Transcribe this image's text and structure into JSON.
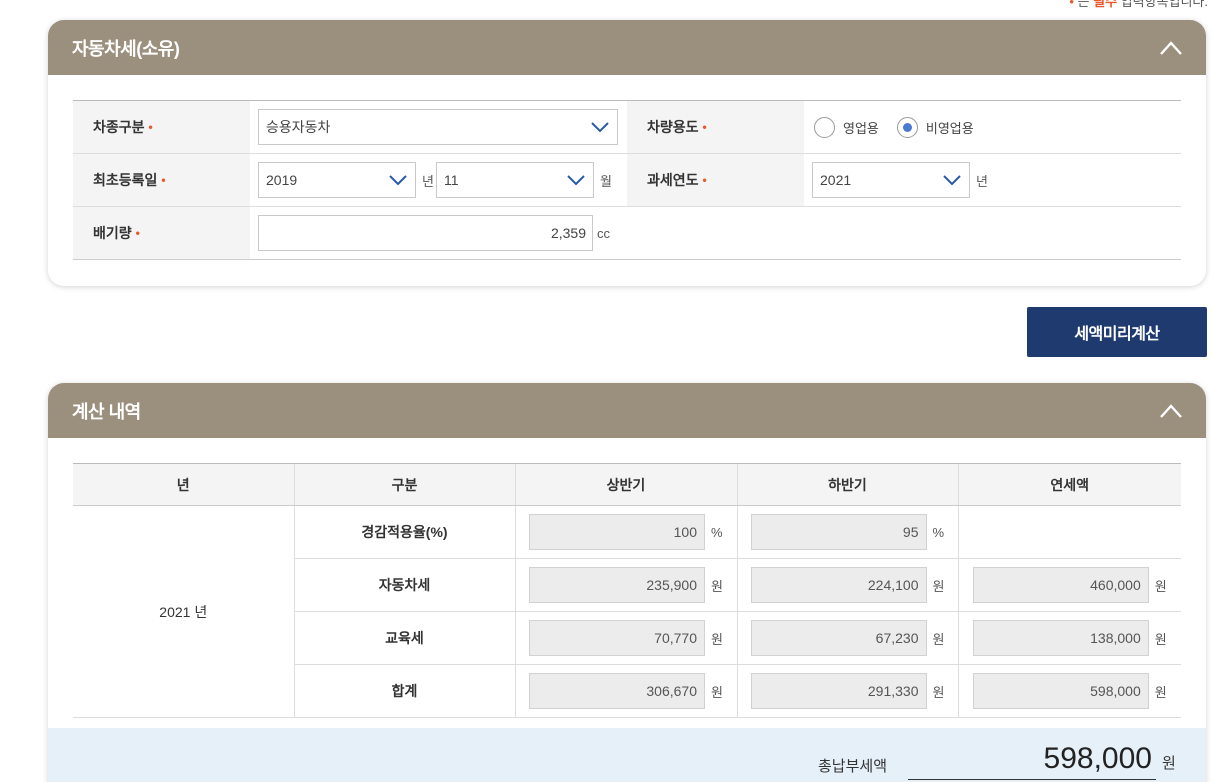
{
  "note": {
    "mark": "•",
    "prefix": "는",
    "required_word": "필수",
    "suffix": "입력항목입니다."
  },
  "vehicle_card": {
    "title": "자동차세(소유)",
    "car_type": {
      "label": "차종구분",
      "value": "승용자동차"
    },
    "usage": {
      "label": "차량용도",
      "options": [
        "영업용",
        "비영업용"
      ],
      "selected": "비영업용"
    },
    "first_reg": {
      "label": "최초등록일",
      "year": "2019",
      "year_unit": "년",
      "month": "11",
      "month_unit": "월"
    },
    "tax_year": {
      "label": "과세연도",
      "value": "2021",
      "unit": "년"
    },
    "displacement": {
      "label": "배기량",
      "value": "2,359",
      "unit": "cc"
    },
    "required_mark": "•"
  },
  "calc_button": "세액미리계산",
  "result_card": {
    "title": "계산 내역",
    "headers": [
      "년",
      "구분",
      "상반기",
      "하반기",
      "연세액"
    ],
    "year_cell": "2021 년",
    "rows": [
      {
        "label": "경감적용율(%)",
        "first": "100",
        "first_unit": "%",
        "second": "95",
        "second_unit": "%",
        "annual": "",
        "annual_unit": ""
      },
      {
        "label": "자동차세",
        "first": "235,900",
        "first_unit": "원",
        "second": "224,100",
        "second_unit": "원",
        "annual": "460,000",
        "annual_unit": "원"
      },
      {
        "label": "교육세",
        "first": "70,770",
        "first_unit": "원",
        "second": "67,230",
        "second_unit": "원",
        "annual": "138,000",
        "annual_unit": "원"
      },
      {
        "label": "합계",
        "first": "306,670",
        "first_unit": "원",
        "second": "291,330",
        "second_unit": "원",
        "annual": "598,000",
        "annual_unit": "원"
      }
    ],
    "total": {
      "label": "총납부세액",
      "value": "598,000",
      "unit": "원"
    }
  },
  "colors": {
    "header_bg": "#9b8f7e",
    "button_bg": "#1f3a6e",
    "required": "#e8562a",
    "radio_on": "#4a7bd0",
    "total_bg": "#e6f0f8"
  }
}
